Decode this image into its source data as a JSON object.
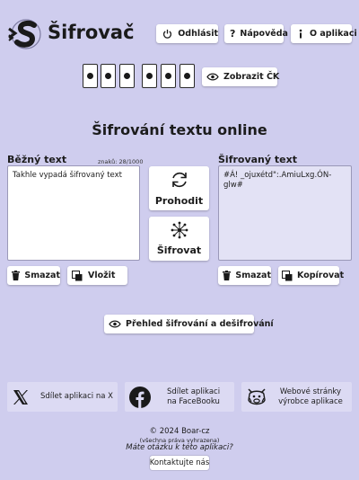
{
  "header": {
    "app_title": "Šifrovač",
    "logout_label": "Odhlásit",
    "help_label": "Nápověda",
    "about_label": "O aplikaci"
  },
  "pin": {
    "digits": [
      "•",
      "•",
      "•",
      "•",
      "•",
      "•"
    ],
    "show_label": "Zobrazit ČK"
  },
  "main": {
    "title": "Šifrování textu online"
  },
  "plain": {
    "label": "Běžný text",
    "counter": "znaků: 28/1000",
    "value": "Takhle vypadá šifrovaný text",
    "clear_label": "Smazat",
    "paste_label": "Vložit"
  },
  "actions": {
    "swap_label": "Prohodit",
    "encrypt_label": "Šifrovat"
  },
  "cipher": {
    "label": "Šifrovaný text",
    "value": "#Á! _ojuxétd\":.AmiuLxg.ÓN-glw#",
    "clear_label": "Smazat",
    "copy_label": "Kopírovat"
  },
  "overview": {
    "label": "Přehled šifrování a dešifrování"
  },
  "share": {
    "x_label": "Sdílet aplikaci na X",
    "facebook_line1": "Sdílet aplikaci",
    "facebook_line2": "na FaceBooku",
    "web_line1": "Webové stránky",
    "web_line2": "výrobce aplikace"
  },
  "footer": {
    "copyright": "© 2024 Boar-cz",
    "rights": "(všechna práva vyhrazena)",
    "question": "Máte otázku k této aplikaci?",
    "contact_label": "Kontaktujte nás"
  },
  "colors": {
    "background": "#cfcdee",
    "button": "#ffffff",
    "readonly_field": "#e3e2f5"
  }
}
